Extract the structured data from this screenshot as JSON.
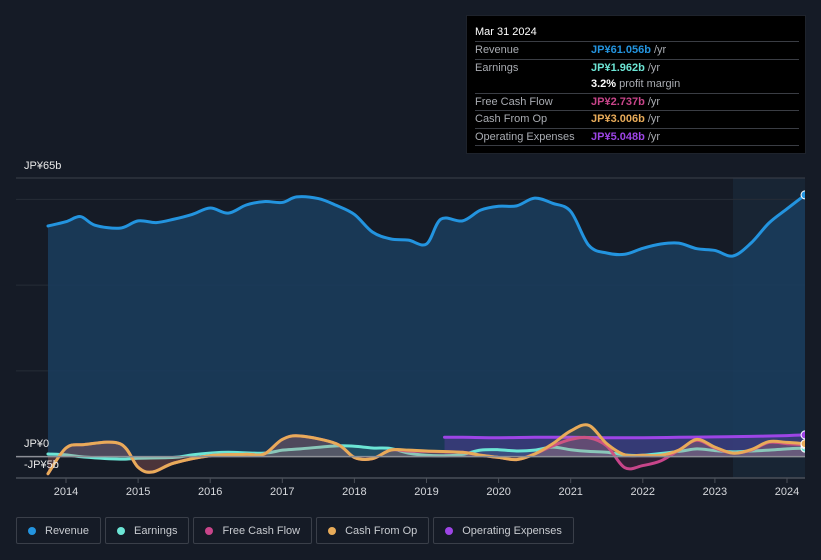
{
  "tooltip": {
    "date": "Mar 31 2024",
    "rows": [
      {
        "label": "Revenue",
        "value": "JP¥61.056b",
        "unit": "/yr",
        "color": "#2394df"
      },
      {
        "label": "Earnings",
        "value": "JP¥1.962b",
        "unit": "/yr",
        "color": "#6ce5d5"
      },
      {
        "label": "",
        "value": "3.2%",
        "unit": "profit margin",
        "color": "#ffffff"
      },
      {
        "label": "Free Cash Flow",
        "value": "JP¥2.737b",
        "unit": "/yr",
        "color": "#c8458a"
      },
      {
        "label": "Cash From Op",
        "value": "JP¥3.006b",
        "unit": "/yr",
        "color": "#e8ab59"
      },
      {
        "label": "Operating Expenses",
        "value": "JP¥5.048b",
        "unit": "/yr",
        "color": "#9d45e6"
      }
    ]
  },
  "legend": [
    {
      "label": "Revenue",
      "color": "#2394df"
    },
    {
      "label": "Earnings",
      "color": "#6ce5d5"
    },
    {
      "label": "Free Cash Flow",
      "color": "#c8458a"
    },
    {
      "label": "Cash From Op",
      "color": "#e8ab59"
    },
    {
      "label": "Operating Expenses",
      "color": "#9d45e6"
    }
  ],
  "chart_data": {
    "type": "line",
    "title": "",
    "xlabel": "",
    "ylabel": "",
    "y_labels": {
      "top": "JP¥65b",
      "zero": "JP¥0",
      "bottom": "-JP¥5b"
    },
    "ylim": [
      -5,
      65
    ],
    "xlim": [
      2013.75,
      2024.25
    ],
    "x_ticks": [
      2014,
      2015,
      2016,
      2017,
      2018,
      2019,
      2020,
      2021,
      2022,
      2023,
      2024
    ],
    "x_tick_labels": [
      "2014",
      "2015",
      "2016",
      "2017",
      "2018",
      "2019",
      "2020",
      "2021",
      "2022",
      "2023",
      "2024"
    ],
    "highlight_from": 2023.25,
    "grid": true,
    "series": [
      {
        "name": "Revenue",
        "color": "#2394df",
        "fill": true,
        "points": [
          [
            2013.75,
            53.8
          ],
          [
            2014.0,
            54.8
          ],
          [
            2014.2,
            56.0
          ],
          [
            2014.4,
            54.0
          ],
          [
            2014.75,
            53.3
          ],
          [
            2015.0,
            55.0
          ],
          [
            2015.25,
            54.6
          ],
          [
            2015.5,
            55.4
          ],
          [
            2015.75,
            56.5
          ],
          [
            2016.0,
            58.0
          ],
          [
            2016.25,
            56.8
          ],
          [
            2016.5,
            58.7
          ],
          [
            2016.75,
            59.5
          ],
          [
            2017.0,
            59.3
          ],
          [
            2017.2,
            60.6
          ],
          [
            2017.5,
            60.2
          ],
          [
            2017.75,
            58.6
          ],
          [
            2018.0,
            56.5
          ],
          [
            2018.25,
            52.4
          ],
          [
            2018.5,
            50.8
          ],
          [
            2018.75,
            50.5
          ],
          [
            2019.0,
            49.6
          ],
          [
            2019.2,
            55.4
          ],
          [
            2019.5,
            55.0
          ],
          [
            2019.75,
            57.5
          ],
          [
            2020.0,
            58.4
          ],
          [
            2020.25,
            58.5
          ],
          [
            2020.5,
            60.3
          ],
          [
            2020.75,
            59.1
          ],
          [
            2021.0,
            57.2
          ],
          [
            2021.25,
            49.3
          ],
          [
            2021.5,
            47.5
          ],
          [
            2021.75,
            47.2
          ],
          [
            2022.0,
            48.6
          ],
          [
            2022.25,
            49.6
          ],
          [
            2022.5,
            49.8
          ],
          [
            2022.75,
            48.5
          ],
          [
            2023.0,
            48.1
          ],
          [
            2023.25,
            46.8
          ],
          [
            2023.5,
            49.8
          ],
          [
            2023.75,
            54.5
          ],
          [
            2024.0,
            57.8
          ],
          [
            2024.25,
            61.056
          ]
        ]
      },
      {
        "name": "Earnings",
        "color": "#6ce5d5",
        "fill": true,
        "points": [
          [
            2013.75,
            0.6
          ],
          [
            2014.0,
            0.4
          ],
          [
            2014.25,
            -0.1
          ],
          [
            2014.75,
            -0.6
          ],
          [
            2015.0,
            -0.4
          ],
          [
            2015.5,
            -0.2
          ],
          [
            2015.75,
            0.4
          ],
          [
            2016.0,
            0.8
          ],
          [
            2016.25,
            1.0
          ],
          [
            2016.75,
            0.8
          ],
          [
            2017.0,
            1.5
          ],
          [
            2017.25,
            1.8
          ],
          [
            2017.75,
            2.5
          ],
          [
            2018.0,
            2.4
          ],
          [
            2018.25,
            2.0
          ],
          [
            2018.5,
            1.9
          ],
          [
            2018.75,
            0.8
          ],
          [
            2019.0,
            0.3
          ],
          [
            2019.25,
            0.2
          ],
          [
            2019.5,
            0.5
          ],
          [
            2019.75,
            1.5
          ],
          [
            2020.0,
            1.6
          ],
          [
            2020.25,
            1.3
          ],
          [
            2020.5,
            1.5
          ],
          [
            2020.75,
            2.2
          ],
          [
            2021.0,
            1.6
          ],
          [
            2021.25,
            1.2
          ],
          [
            2021.5,
            1.0
          ],
          [
            2021.75,
            0.4
          ],
          [
            2022.0,
            0.3
          ],
          [
            2022.5,
            1.2
          ],
          [
            2022.75,
            1.8
          ],
          [
            2023.0,
            1.4
          ],
          [
            2023.25,
            1.1
          ],
          [
            2023.5,
            1.3
          ],
          [
            2023.75,
            1.5
          ],
          [
            2024.0,
            1.8
          ],
          [
            2024.25,
            1.962
          ]
        ]
      },
      {
        "name": "Free Cash Flow",
        "color": "#c8458a",
        "fill": true,
        "points": [
          [
            2013.75,
            -4.0
          ],
          [
            2014.0,
            2.0
          ],
          [
            2014.25,
            2.8
          ],
          [
            2014.75,
            3.0
          ],
          [
            2015.0,
            -2.5
          ],
          [
            2015.2,
            -3.6
          ],
          [
            2015.5,
            -1.5
          ],
          [
            2016.0,
            0.2
          ],
          [
            2016.5,
            0.5
          ],
          [
            2016.75,
            0.6
          ],
          [
            2017.0,
            4.0
          ],
          [
            2017.25,
            4.8
          ],
          [
            2017.75,
            3.0
          ],
          [
            2018.0,
            -0.2
          ],
          [
            2018.25,
            -0.5
          ],
          [
            2018.5,
            1.5
          ],
          [
            2018.75,
            1.3
          ],
          [
            2019.0,
            1.2
          ],
          [
            2019.5,
            1.0
          ],
          [
            2019.75,
            0.3
          ],
          [
            2020.0,
            -0.2
          ],
          [
            2020.25,
            -0.7
          ],
          [
            2020.5,
            0.6
          ],
          [
            2020.75,
            2.5
          ],
          [
            2021.0,
            4.0
          ],
          [
            2021.25,
            4.4
          ],
          [
            2021.5,
            2.5
          ],
          [
            2021.75,
            -2.6
          ],
          [
            2022.0,
            -2.1
          ],
          [
            2022.25,
            -1.0
          ],
          [
            2022.5,
            1.5
          ],
          [
            2022.75,
            3.8
          ],
          [
            2023.0,
            2.0
          ],
          [
            2023.25,
            0.8
          ],
          [
            2023.5,
            1.5
          ],
          [
            2023.75,
            3.3
          ],
          [
            2024.0,
            3.0
          ],
          [
            2024.25,
            2.737
          ]
        ]
      },
      {
        "name": "Cash From Op",
        "color": "#e8ab59",
        "fill": true,
        "points": [
          [
            2013.75,
            -4.0
          ],
          [
            2014.0,
            2.0
          ],
          [
            2014.25,
            2.8
          ],
          [
            2014.75,
            3.0
          ],
          [
            2015.0,
            -2.5
          ],
          [
            2015.2,
            -3.6
          ],
          [
            2015.5,
            -1.5
          ],
          [
            2016.0,
            0.2
          ],
          [
            2016.5,
            0.5
          ],
          [
            2016.75,
            0.6
          ],
          [
            2017.0,
            4.0
          ],
          [
            2017.25,
            4.8
          ],
          [
            2017.75,
            3.0
          ],
          [
            2018.0,
            -0.2
          ],
          [
            2018.25,
            -0.5
          ],
          [
            2018.5,
            1.5
          ],
          [
            2018.75,
            1.5
          ],
          [
            2019.0,
            1.3
          ],
          [
            2019.5,
            1.0
          ],
          [
            2019.75,
            0.3
          ],
          [
            2020.0,
            -0.2
          ],
          [
            2020.25,
            -0.7
          ],
          [
            2020.5,
            0.6
          ],
          [
            2020.75,
            3.0
          ],
          [
            2021.0,
            6.0
          ],
          [
            2021.25,
            7.3
          ],
          [
            2021.5,
            3.0
          ],
          [
            2021.75,
            0.4
          ],
          [
            2022.0,
            0.3
          ],
          [
            2022.25,
            0.3
          ],
          [
            2022.5,
            1.5
          ],
          [
            2022.75,
            4.0
          ],
          [
            2023.0,
            2.2
          ],
          [
            2023.25,
            0.8
          ],
          [
            2023.5,
            1.6
          ],
          [
            2023.75,
            3.5
          ],
          [
            2024.0,
            3.3
          ],
          [
            2024.25,
            3.006
          ]
        ]
      },
      {
        "name": "Operating Expenses",
        "color": "#9d45e6",
        "fill": true,
        "points": [
          [
            2019.25,
            4.5
          ],
          [
            2019.5,
            4.5
          ],
          [
            2020.0,
            4.4
          ],
          [
            2020.5,
            4.5
          ],
          [
            2021.0,
            4.5
          ],
          [
            2021.5,
            4.4
          ],
          [
            2022.0,
            4.4
          ],
          [
            2022.5,
            4.5
          ],
          [
            2023.0,
            4.6
          ],
          [
            2023.5,
            4.7
          ],
          [
            2024.0,
            4.9
          ],
          [
            2024.25,
            5.048
          ]
        ]
      }
    ]
  }
}
